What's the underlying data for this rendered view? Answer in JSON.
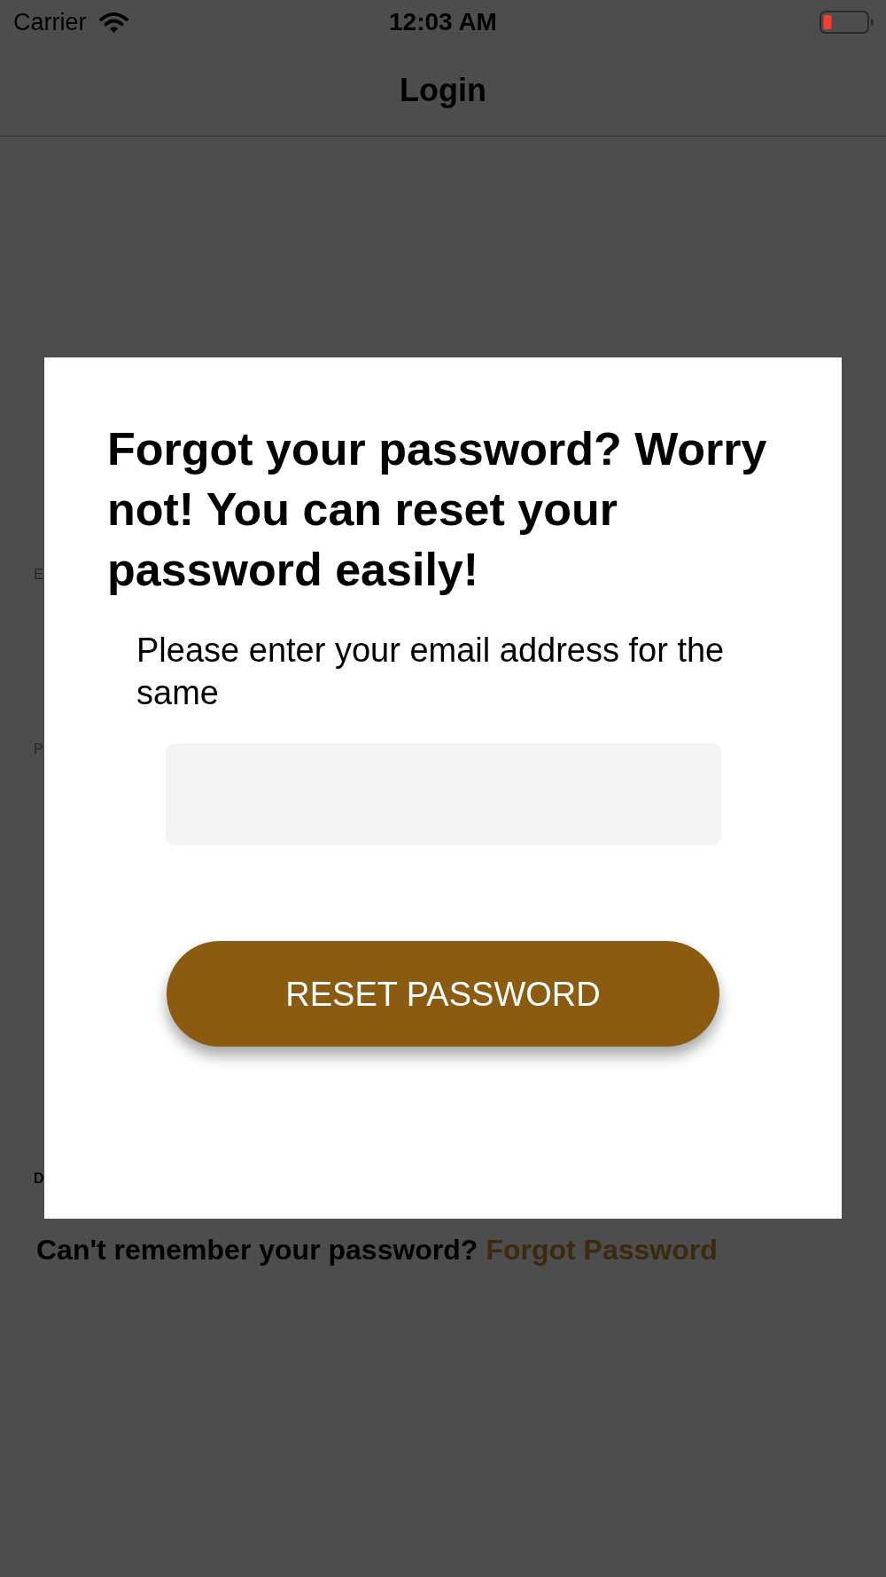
{
  "status_bar": {
    "carrier": "Carrier",
    "time": "12:03 AM"
  },
  "nav_bar": {
    "title": "Login"
  },
  "background_form": {
    "labels": [
      {
        "text": "E",
        "kind": "label"
      },
      {
        "text": "P",
        "kind": "label"
      },
      {
        "text": "D",
        "kind": "heading"
      }
    ],
    "prompt": {
      "text": "Can't remember your password?",
      "link": "Forgot Password"
    }
  },
  "dialog": {
    "title": "Forgot your password? Worry not! You can reset your password easily!",
    "message": "Please enter your email address for the same",
    "button": "RESET PASSWORD"
  }
}
